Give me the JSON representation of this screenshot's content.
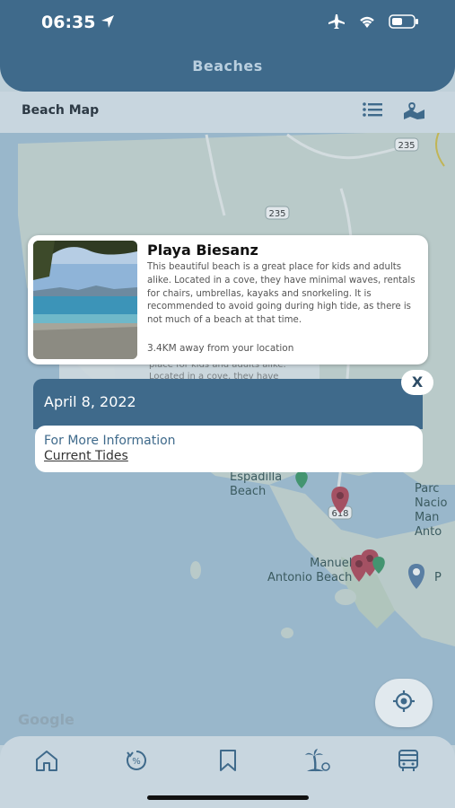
{
  "status_bar": {
    "time": "06:35"
  },
  "header": {
    "title": "Beaches"
  },
  "subbar": {
    "title": "Beach Map"
  },
  "map": {
    "road_labels": [
      "235",
      "235",
      "618"
    ],
    "place_labels": {
      "espadilla": "Espadilla\nBeach",
      "manuel_antonio": "Manuel\nAntonio Beach",
      "parque": "Parc\nNacio\nMan\nAnto",
      "edge_p": "P"
    },
    "attribution": "Google",
    "background_card_text": "place for kids and adults alike.\nLocated in a cove, they have"
  },
  "beach_card": {
    "name": "Playa Biesanz",
    "description": "This beautiful beach is a great place for kids and adults alike. Located in a cove, they have minimal waves, rentals for chairs, umbrellas, kayaks and snorkeling. It is recommended to avoid going during high tide, as there is not much of a beach at that time.",
    "distance": "3.4KM away from your location"
  },
  "tide_panel": {
    "date": "April 8, 2022",
    "info_label": "For More Information",
    "link_label": "Current Tides",
    "close_label": "X"
  },
  "bottom_nav": {
    "items": [
      {
        "icon": "home-icon"
      },
      {
        "icon": "percent-timer-icon"
      },
      {
        "icon": "bookmark-icon"
      },
      {
        "icon": "palm-tree-icon"
      },
      {
        "icon": "bus-icon"
      }
    ]
  },
  "colors": {
    "primary": "#3f6a8b",
    "marker_red": "#b5485a",
    "marker_green": "#3f9a6a",
    "marker_blue": "#5a7fa8"
  }
}
